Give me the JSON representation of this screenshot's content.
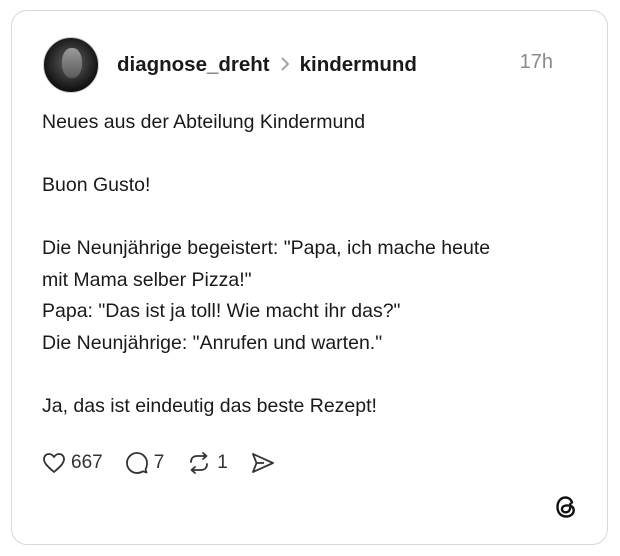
{
  "post": {
    "username": "diagnose_dreht",
    "community": "kindermund",
    "time": "17h",
    "lines": [
      "Neues aus der Abteilung Kindermund",
      "",
      "Buon Gusto!",
      "",
      "Die Neunjährige begeistert: \"Papa, ich mache heute",
      "mit Mama selber Pizza!\"",
      "Papa: \"Das ist ja toll! Wie macht ihr das?\"",
      "Die Neunjährige: \"Anrufen und warten.\"",
      "",
      "Ja, das ist eindeutig das beste Rezept!"
    ]
  },
  "actions": {
    "likes": "667",
    "replies": "7",
    "reposts": "1"
  },
  "icons": {
    "like": "heart-icon",
    "reply": "comment-bubble-icon",
    "repost": "repost-icon",
    "share": "share-send-icon",
    "brand": "threads-logo-icon"
  }
}
